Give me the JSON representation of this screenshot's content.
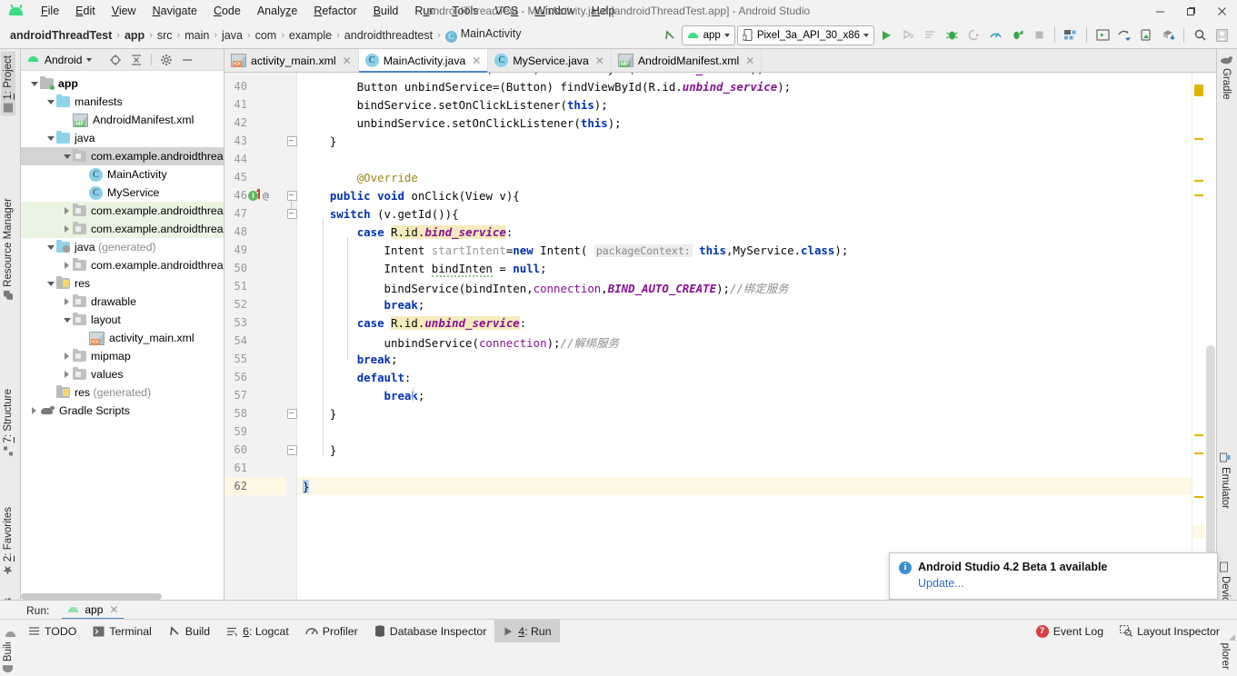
{
  "window": {
    "title": "androidThreadTest - MainActivity.java [androidThreadTest.app] - Android Studio",
    "minimize": "–",
    "maximize": "❐",
    "close": "✕"
  },
  "menubar": {
    "items": [
      {
        "label": "File",
        "mnemonic": "F"
      },
      {
        "label": "Edit",
        "mnemonic": "E"
      },
      {
        "label": "View",
        "mnemonic": "V"
      },
      {
        "label": "Navigate",
        "mnemonic": "N"
      },
      {
        "label": "Code",
        "mnemonic": "C"
      },
      {
        "label": "Analyze",
        "mnemonic": "z"
      },
      {
        "label": "Refactor",
        "mnemonic": "R"
      },
      {
        "label": "Build",
        "mnemonic": "B"
      },
      {
        "label": "Run",
        "mnemonic": "u"
      },
      {
        "label": "Tools",
        "mnemonic": "T"
      },
      {
        "label": "VCS",
        "mnemonic": "S"
      },
      {
        "label": "Window",
        "mnemonic": "W"
      },
      {
        "label": "Help",
        "mnemonic": "H"
      }
    ]
  },
  "breadcrumb": {
    "items": [
      "androidThreadTest",
      "app",
      "src",
      "main",
      "java",
      "com",
      "example",
      "androidthreadtest",
      "MainActivity"
    ],
    "class_badge": "C",
    "separator": "›"
  },
  "toolbar": {
    "run_config": "app",
    "device": "Pixel_3a_API_30_x86",
    "icons": [
      "run-icon",
      "apply-changes-icon",
      "apply-code-changes-icon",
      "debug-icon",
      "attach-debugger-icon",
      "profiler-icon",
      "run-with-coverage-icon",
      "stop-icon",
      "avd-manager-icon",
      "sdk-manager-icon",
      "sync-gradle-icon",
      "device-manager-icon",
      "download-icon",
      "search-icon",
      "profile-icon"
    ]
  },
  "left_rail": [
    {
      "label": "1: Project",
      "mnemonic": "1",
      "selected": true
    },
    {
      "label": "Resource Manager",
      "mnemonic": "",
      "selected": false
    },
    {
      "label": "7: Structure",
      "mnemonic": "7",
      "selected": false
    },
    {
      "label": "2: Favorites",
      "mnemonic": "2",
      "selected": false
    },
    {
      "label": "Build Variants",
      "mnemonic": "",
      "selected": false
    }
  ],
  "right_rail": [
    {
      "label": "Gradle"
    },
    {
      "label": "Emulator"
    },
    {
      "label": "Device File Explorer"
    }
  ],
  "project_panel": {
    "title": "Android",
    "header_icons": [
      "locate-icon",
      "collapse-all-icon",
      "settings-gear-icon",
      "hide-icon"
    ],
    "tree": [
      {
        "label": "app",
        "indent": 0,
        "arrow": "down",
        "icon": "module-folder",
        "bold": true,
        "state": "none"
      },
      {
        "label": "manifests",
        "indent": 1,
        "arrow": "down",
        "icon": "folder-blue",
        "bold": false,
        "state": "none"
      },
      {
        "label": "AndroidManifest.xml",
        "indent": 2,
        "arrow": "none",
        "icon": "xml-manifest",
        "bold": false,
        "state": "none"
      },
      {
        "label": "java",
        "indent": 1,
        "arrow": "down",
        "icon": "folder-blue",
        "bold": false,
        "state": "none"
      },
      {
        "label": "com.example.androidthrea",
        "indent": 2,
        "arrow": "down",
        "icon": "folder-package",
        "bold": false,
        "state": "selected"
      },
      {
        "label": "MainActivity",
        "indent": 3,
        "arrow": "none",
        "icon": "class",
        "bold": false,
        "state": "none"
      },
      {
        "label": "MyService",
        "indent": 3,
        "arrow": "none",
        "icon": "class",
        "bold": false,
        "state": "none"
      },
      {
        "label": "com.example.androidthrea",
        "indent": 2,
        "arrow": "right",
        "icon": "folder-package",
        "bold": false,
        "state": "green"
      },
      {
        "label": "com.example.androidthrea",
        "indent": 2,
        "arrow": "right",
        "icon": "folder-package",
        "bold": false,
        "state": "green"
      },
      {
        "label": "java (generated)",
        "indent": 1,
        "arrow": "down",
        "icon": "folder-generated",
        "bold": false,
        "state": "none",
        "suffix": "(generated)"
      },
      {
        "label": "com.example.androidthrea",
        "indent": 2,
        "arrow": "right",
        "icon": "folder-package",
        "bold": false,
        "state": "none"
      },
      {
        "label": "res",
        "indent": 1,
        "arrow": "down",
        "icon": "folder-res",
        "bold": false,
        "state": "none"
      },
      {
        "label": "drawable",
        "indent": 2,
        "arrow": "right",
        "icon": "folder-package",
        "bold": false,
        "state": "none"
      },
      {
        "label": "layout",
        "indent": 2,
        "arrow": "down",
        "icon": "folder-package",
        "bold": false,
        "state": "none"
      },
      {
        "label": "activity_main.xml",
        "indent": 3,
        "arrow": "none",
        "icon": "xml-layout",
        "bold": false,
        "state": "none"
      },
      {
        "label": "mipmap",
        "indent": 2,
        "arrow": "right",
        "icon": "folder-package",
        "bold": false,
        "state": "none"
      },
      {
        "label": "values",
        "indent": 2,
        "arrow": "right",
        "icon": "folder-package",
        "bold": false,
        "state": "none"
      },
      {
        "label": "res (generated)",
        "indent": 1,
        "arrow": "none",
        "icon": "folder-res",
        "bold": false,
        "state": "none",
        "suffix": "(generated)"
      },
      {
        "label": "Gradle Scripts",
        "indent": 0,
        "arrow": "right",
        "icon": "gradle",
        "bold": false,
        "state": "none"
      }
    ]
  },
  "editor_tabs": [
    {
      "label": "activity_main.xml",
      "icon": "xml-layout-icon",
      "active": false
    },
    {
      "label": "MainActivity.java",
      "icon": "class-icon",
      "active": true
    },
    {
      "label": "MyService.java",
      "icon": "class-icon",
      "active": false
    },
    {
      "label": "AndroidManifest.xml",
      "icon": "xml-manifest-icon",
      "active": false
    }
  ],
  "code": {
    "first_visible_line": 39,
    "last_visible_line": 62,
    "caret_line": 62,
    "lines": [
      {
        "n": 39,
        "text": "        Button bindService=(Button) findViewById(R.id.bind_service);",
        "clipped": true
      },
      {
        "n": 40,
        "text": "        Button unbindService=(Button) findViewById(R.id.unbind_service);"
      },
      {
        "n": 41,
        "text": "        bindService.setOnClickListener(this);"
      },
      {
        "n": 42,
        "text": "        unbindService.setOnClickListener(this);"
      },
      {
        "n": 43,
        "text": "    }"
      },
      {
        "n": 44,
        "text": ""
      },
      {
        "n": 45,
        "text": "        @Override"
      },
      {
        "n": 46,
        "text": "    public void onClick(View v){"
      },
      {
        "n": 47,
        "text": "    switch (v.getId()){"
      },
      {
        "n": 48,
        "text": "        case R.id.bind_service:"
      },
      {
        "n": 49,
        "text": "            Intent startIntent=new Intent( packageContext: this,MyService.class);"
      },
      {
        "n": 50,
        "text": "            Intent bindInten = null;"
      },
      {
        "n": 51,
        "text": "            bindService(bindInten,connection,BIND_AUTO_CREATE);//绑定服务"
      },
      {
        "n": 52,
        "text": "            break;"
      },
      {
        "n": 53,
        "text": "        case R.id.unbind_service:"
      },
      {
        "n": 54,
        "text": "            unbindService(connection);//解绑服务"
      },
      {
        "n": 55,
        "text": "        break;"
      },
      {
        "n": 56,
        "text": "        default:"
      },
      {
        "n": 57,
        "text": "            break;"
      },
      {
        "n": 58,
        "text": "    }"
      },
      {
        "n": 59,
        "text": ""
      },
      {
        "n": 60,
        "text": "    }"
      },
      {
        "n": 61,
        "text": ""
      },
      {
        "n": 62,
        "text": "}"
      }
    ],
    "inlay_hint": "packageContext:",
    "comment_bind": "//绑定服务",
    "comment_unbind": "//解绑服务",
    "gutter_marker_at": 46,
    "gutter_annotation": "@"
  },
  "notification": {
    "title": "Android Studio 4.2 Beta 1 available",
    "link": "Update...",
    "icon": "info-icon"
  },
  "run_strip": {
    "label": "Run:",
    "tab": "app",
    "close": "✕"
  },
  "status_bar": {
    "left_buttons": [
      {
        "label": "TODO",
        "icon": "todo-icon",
        "mnemonic": "",
        "active": false
      },
      {
        "label": "Terminal",
        "icon": "terminal-icon",
        "mnemonic": "",
        "active": false
      },
      {
        "label": "Build",
        "icon": "build-hammer-icon",
        "mnemonic": "",
        "active": false
      },
      {
        "label": "6: Logcat",
        "icon": "logcat-icon",
        "mnemonic": "6",
        "active": false
      },
      {
        "label": "Profiler",
        "icon": "profiler-icon",
        "mnemonic": "",
        "active": false
      },
      {
        "label": "Database Inspector",
        "icon": "database-icon",
        "mnemonic": "",
        "active": false
      },
      {
        "label": "4: Run",
        "icon": "run-triangle-icon",
        "mnemonic": "4",
        "active": true
      }
    ],
    "right_buttons": [
      {
        "label": "Event Log",
        "icon": "event-log-icon",
        "badge": "7"
      },
      {
        "label": "Layout Inspector",
        "icon": "layout-inspector-icon",
        "badge": ""
      }
    ]
  },
  "colors": {
    "accent": "#4a86c8",
    "keyword": "#0033b3",
    "field": "#871094",
    "annotation": "#9e880d",
    "comment": "#8c8c8c",
    "highlight": "#f6ebbe",
    "caret_line": "#fdf8e4",
    "marker": "#e0b400",
    "android_green": "#3ddc84",
    "badge_red": "#d94040",
    "link": "#2a6dba"
  }
}
